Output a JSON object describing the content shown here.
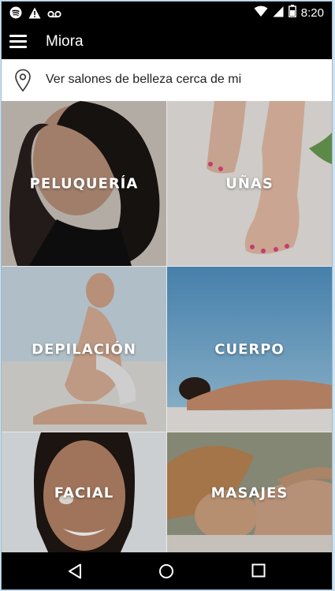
{
  "status_bar": {
    "time": "8:20",
    "icons_left": [
      "spotify-icon",
      "warning-icon",
      "voicemail-icon"
    ],
    "icons_right": [
      "wifi-icon",
      "signal-icon",
      "battery-icon"
    ]
  },
  "app_bar": {
    "title": "Miora",
    "menu_icon": "hamburger-menu-icon"
  },
  "location_bar": {
    "icon": "location-pin-icon",
    "text": "Ver salones de belleza cerca de mi"
  },
  "categories": [
    {
      "label": "PELUQUERÍA"
    },
    {
      "label": "UÑAS"
    },
    {
      "label": "DEPILACIÓN"
    },
    {
      "label": "CUERPO"
    },
    {
      "label": "FACIAL"
    },
    {
      "label": "MASAJES"
    }
  ],
  "nav_bar": {
    "back_icon": "back-triangle-icon",
    "home_icon": "home-circle-icon",
    "recents_icon": "recents-square-icon"
  },
  "colors": {
    "bar_background": "#000000",
    "location_background": "#ffffff",
    "tile_label": "#ffffff"
  }
}
